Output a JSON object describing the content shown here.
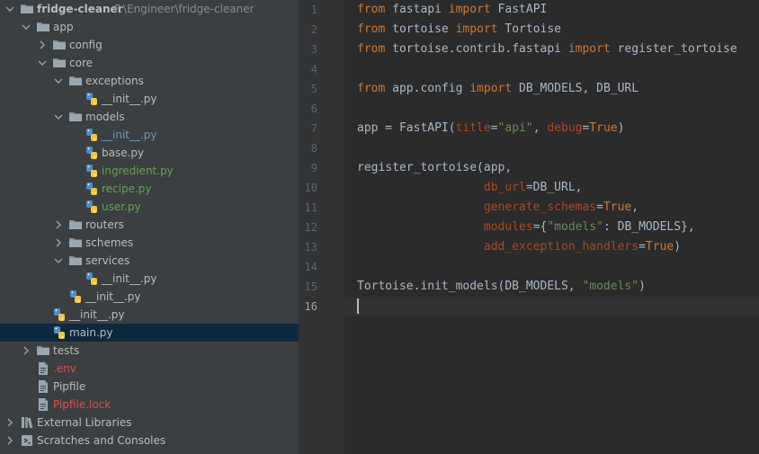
{
  "project_tree": {
    "root": {
      "name": "fridge-cleaner",
      "path": "F:\\Engineer\\fridge-cleaner"
    },
    "items": [
      {
        "label": "app",
        "level": 1,
        "type": "folder",
        "expanded": true,
        "color": "default"
      },
      {
        "label": "config",
        "level": 2,
        "type": "folder",
        "expanded": false,
        "color": "default"
      },
      {
        "label": "core",
        "level": 2,
        "type": "folder",
        "expanded": true,
        "color": "default"
      },
      {
        "label": "exceptions",
        "level": 3,
        "type": "folder",
        "expanded": true,
        "color": "default"
      },
      {
        "label": "__init__.py",
        "level": 4,
        "type": "py",
        "color": "default"
      },
      {
        "label": "models",
        "level": 3,
        "type": "folder",
        "expanded": true,
        "color": "default"
      },
      {
        "label": "__init__.py",
        "level": 4,
        "type": "py",
        "color": "blue"
      },
      {
        "label": "base.py",
        "level": 4,
        "type": "py",
        "color": "default"
      },
      {
        "label": "ingredient.py",
        "level": 4,
        "type": "py",
        "color": "green"
      },
      {
        "label": "recipe.py",
        "level": 4,
        "type": "py",
        "color": "green"
      },
      {
        "label": "user.py",
        "level": 4,
        "type": "py",
        "color": "green"
      },
      {
        "label": "routers",
        "level": 3,
        "type": "folder",
        "expanded": false,
        "color": "default"
      },
      {
        "label": "schemes",
        "level": 3,
        "type": "folder",
        "expanded": false,
        "color": "default"
      },
      {
        "label": "services",
        "level": 3,
        "type": "folder",
        "expanded": true,
        "color": "default"
      },
      {
        "label": "__init__.py",
        "level": 4,
        "type": "py",
        "color": "default"
      },
      {
        "label": "__init__.py",
        "level": 3,
        "type": "py",
        "color": "default"
      },
      {
        "label": "__init__.py",
        "level": 2,
        "type": "py",
        "color": "default"
      },
      {
        "label": "main.py",
        "level": 2,
        "type": "py",
        "color": "default",
        "selected": true
      },
      {
        "label": "tests",
        "level": 1,
        "type": "folder",
        "expanded": false,
        "color": "default"
      },
      {
        "label": ".env",
        "level": 1,
        "type": "file",
        "color": "red"
      },
      {
        "label": "Pipfile",
        "level": 1,
        "type": "file",
        "color": "default"
      },
      {
        "label": "Pipfile.lock",
        "level": 1,
        "type": "file",
        "color": "red"
      },
      {
        "label": "External Libraries",
        "level": 0,
        "type": "libraries",
        "expanded": false,
        "color": "default"
      },
      {
        "label": "Scratches and Consoles",
        "level": 0,
        "type": "scratches",
        "expanded": false,
        "color": "default"
      }
    ]
  },
  "editor": {
    "current_line": 16,
    "lines": [
      [
        [
          "kw",
          "from"
        ],
        [
          "t",
          " fastapi "
        ],
        [
          "kw",
          "import"
        ],
        [
          "t",
          " FastAPI"
        ]
      ],
      [
        [
          "kw",
          "from"
        ],
        [
          "t",
          " tortoise "
        ],
        [
          "kw",
          "import"
        ],
        [
          "t",
          " Tortoise"
        ]
      ],
      [
        [
          "kw",
          "from"
        ],
        [
          "t",
          " tortoise.contrib.fastapi "
        ],
        [
          "kw",
          "import"
        ],
        [
          "t",
          " register_tortoise"
        ]
      ],
      [],
      [
        [
          "kw",
          "from"
        ],
        [
          "t",
          " app.config "
        ],
        [
          "kw",
          "import"
        ],
        [
          "t",
          " DB_MODELS, DB_URL"
        ]
      ],
      [],
      [
        [
          "t",
          "app = FastAPI("
        ],
        [
          "par",
          "title"
        ],
        [
          "t",
          "="
        ],
        [
          "str",
          "\"api\""
        ],
        [
          "t",
          ", "
        ],
        [
          "par",
          "debug"
        ],
        [
          "t",
          "="
        ],
        [
          "kw",
          "True"
        ],
        [
          "t",
          ")"
        ]
      ],
      [],
      [
        [
          "t",
          "register_tortoise(app,"
        ]
      ],
      [
        [
          "t",
          "                  "
        ],
        [
          "par",
          "db_url"
        ],
        [
          "t",
          "=DB_URL,"
        ]
      ],
      [
        [
          "t",
          "                  "
        ],
        [
          "par",
          "generate_schemas"
        ],
        [
          "t",
          "="
        ],
        [
          "kw",
          "True"
        ],
        [
          "t",
          ","
        ]
      ],
      [
        [
          "t",
          "                  "
        ],
        [
          "par",
          "modules"
        ],
        [
          "t",
          "={"
        ],
        [
          "str",
          "\"models\""
        ],
        [
          "t",
          ": DB_MODELS},"
        ]
      ],
      [
        [
          "t",
          "                  "
        ],
        [
          "par",
          "add_exception_handlers"
        ],
        [
          "t",
          "="
        ],
        [
          "kw",
          "True"
        ],
        [
          "t",
          ")"
        ]
      ],
      [],
      [
        [
          "t",
          "Tortoise.init_models(DB_MODELS, "
        ],
        [
          "str",
          "\"models\""
        ],
        [
          "t",
          ")"
        ]
      ],
      []
    ]
  },
  "colors": {
    "tree_bg": "#3c3f41",
    "editor_bg": "#2b2b2b",
    "selection": "#0d293e",
    "keyword": "#cc7832",
    "string": "#6a8759",
    "param": "#aa4926",
    "vcs_added": "#62a350",
    "vcs_modified": "#6897bb",
    "vcs_ignored": "#d25252"
  }
}
